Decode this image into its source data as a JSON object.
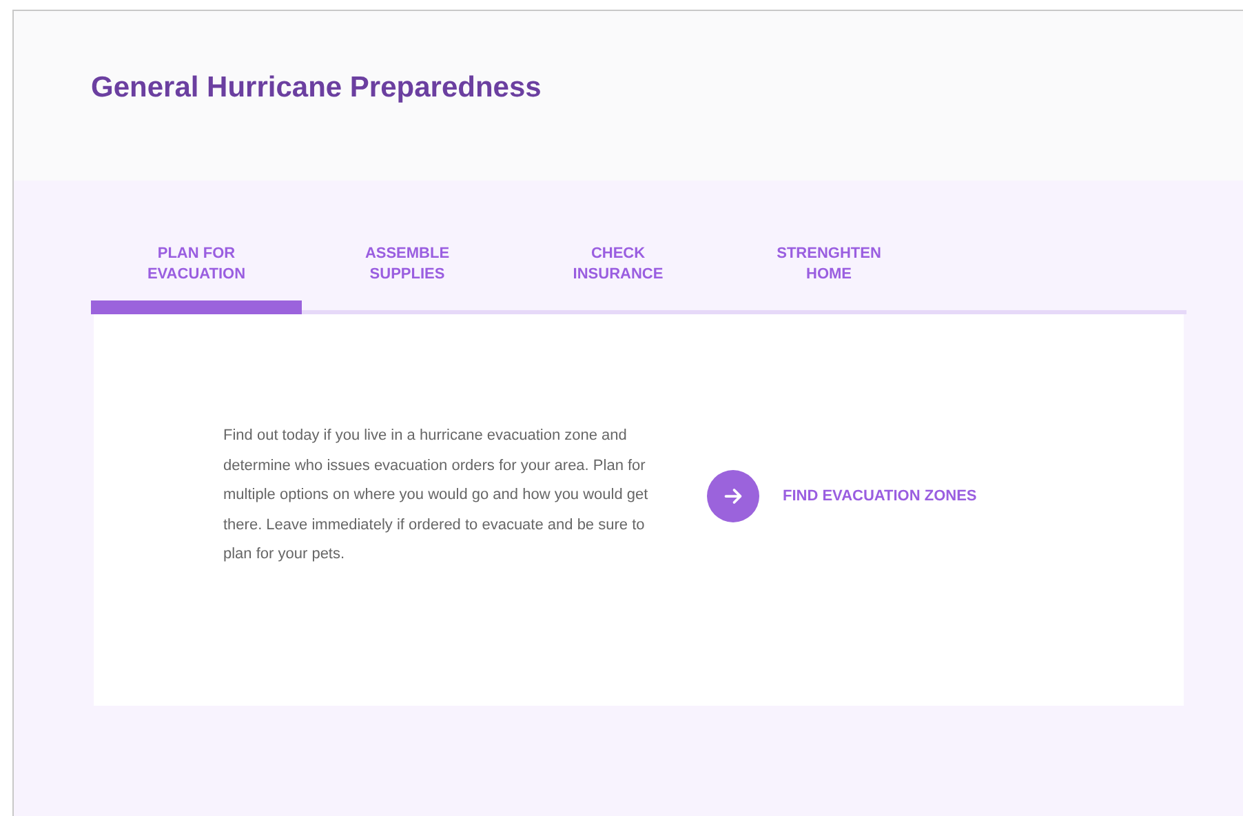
{
  "title": "General Hurricane Preparedness",
  "tabs": [
    {
      "label": "PLAN FOR EVACUATION",
      "selected": true
    },
    {
      "label": "ASSEMBLE SUPPLIES",
      "selected": false
    },
    {
      "label": "CHECK INSURANCE",
      "selected": false
    },
    {
      "label": "STRENGHTEN HOME",
      "selected": false
    }
  ],
  "panel": {
    "text": "Find out today if you live in a hurricane evacuation zone and determine who issues evacuation orders for your area. Plan for multiple options on where you would go and how you would get there. Leave immediately if ordered to evacuate and be sure to plan for your pets.",
    "action": "FIND EVACUATION ZONES"
  }
}
